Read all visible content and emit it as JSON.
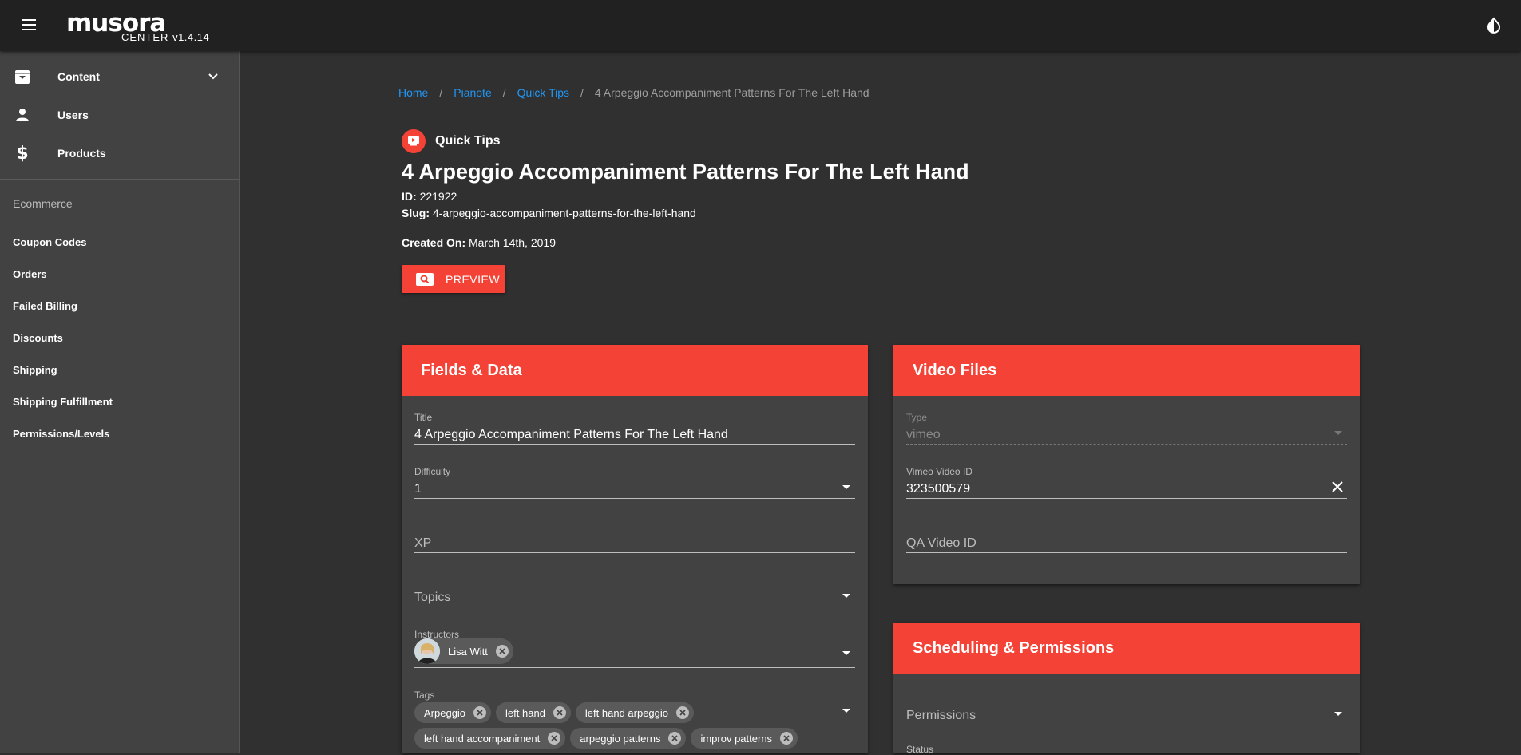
{
  "app": {
    "logo_word": "musora",
    "logo_center": "CENTER",
    "version": "v1.4.14"
  },
  "sidebar": {
    "main_items": [
      {
        "label": "Content",
        "icon": "archive-icon"
      },
      {
        "label": "Users",
        "icon": "person-icon"
      },
      {
        "label": "Products",
        "icon": "dollar-icon"
      }
    ],
    "section_header": "Ecommerce",
    "sub_items": [
      {
        "label": "Coupon Codes"
      },
      {
        "label": "Orders"
      },
      {
        "label": "Failed Billing"
      },
      {
        "label": "Discounts"
      },
      {
        "label": "Shipping"
      },
      {
        "label": "Shipping Fulfillment"
      },
      {
        "label": "Permissions/Levels"
      }
    ]
  },
  "breadcrumb": {
    "items": [
      "Home",
      "Pianote",
      "Quick Tips"
    ],
    "current": "4 Arpeggio Accompaniment Patterns For The Left Hand",
    "separator": "/"
  },
  "content": {
    "type_label": "Quick Tips",
    "title": "4 Arpeggio Accompaniment Patterns For The Left Hand",
    "id_label": "ID:",
    "id_value": "221922",
    "slug_label": "Slug:",
    "slug_value": "4-arpeggio-accompaniment-patterns-for-the-left-hand",
    "created_label": "Created On:",
    "created_value": "March 14th, 2019",
    "preview_label": "PREVIEW"
  },
  "fields_card": {
    "header": "Fields & Data",
    "title_label": "Title",
    "title_value": "4 Arpeggio Accompaniment Patterns For The Left Hand",
    "difficulty_label": "Difficulty",
    "difficulty_value": "1",
    "xp_placeholder": "XP",
    "topics_placeholder": "Topics",
    "instructors_label": "Instructors",
    "instructor_name": "Lisa Witt",
    "tags_label": "Tags",
    "tags_row1": [
      "Arpeggio",
      "left hand",
      "left hand arpeggio"
    ],
    "tags_row2": [
      "left hand accompaniment",
      "arpeggio patterns",
      "improv patterns"
    ]
  },
  "video_card": {
    "header": "Video Files",
    "type_label": "Type",
    "type_value": "vimeo",
    "vimeo_label": "Vimeo Video ID",
    "vimeo_value": "323500579",
    "qa_placeholder": "QA Video ID"
  },
  "scheduling_card": {
    "header": "Scheduling & Permissions",
    "permissions_placeholder": "Permissions",
    "status_label": "Status"
  },
  "colors": {
    "accent": "#f44336",
    "link": "#2196f3",
    "background": "#303030",
    "surface": "#424242",
    "topbar": "#212121"
  }
}
